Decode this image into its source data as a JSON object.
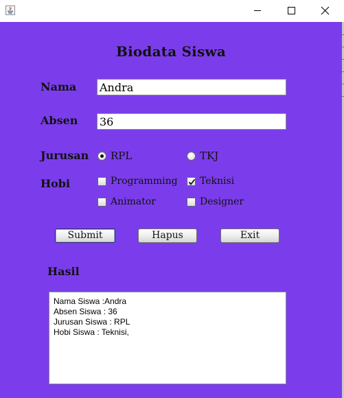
{
  "window": {
    "title": "",
    "buttons": [
      "minimize",
      "maximize",
      "close"
    ]
  },
  "form": {
    "title": "Biodata Siswa",
    "nama_label": "Nama",
    "nama_value": "Andra",
    "absen_label": "Absen",
    "absen_value": "36",
    "jurusan_label": "Jurusan",
    "jurusan_options": [
      {
        "label": "RPL",
        "selected": true
      },
      {
        "label": "TKJ",
        "selected": false
      }
    ],
    "hobi_label": "Hobi",
    "hobi_options": [
      {
        "label": "Programming",
        "checked": false
      },
      {
        "label": "Teknisi",
        "checked": true
      },
      {
        "label": "Animator",
        "checked": false
      },
      {
        "label": "Designer",
        "checked": false
      }
    ],
    "buttons": {
      "submit": "Submit",
      "hapus": "Hapus",
      "exit": "Exit"
    },
    "hasil_label": "Hasil",
    "hasil_lines": [
      "Nama Siswa :Andra",
      "Absen Siswa : 36",
      "Jurusan Siswa : RPL",
      "Hobi Siswa : Teknisi,"
    ]
  },
  "colors": {
    "background": "#7b3deb",
    "titlebar": "#ffffff"
  },
  "icons": {
    "app": "java-app-icon",
    "minimize": "minimize-icon",
    "maximize": "maximize-icon",
    "close": "close-icon"
  }
}
